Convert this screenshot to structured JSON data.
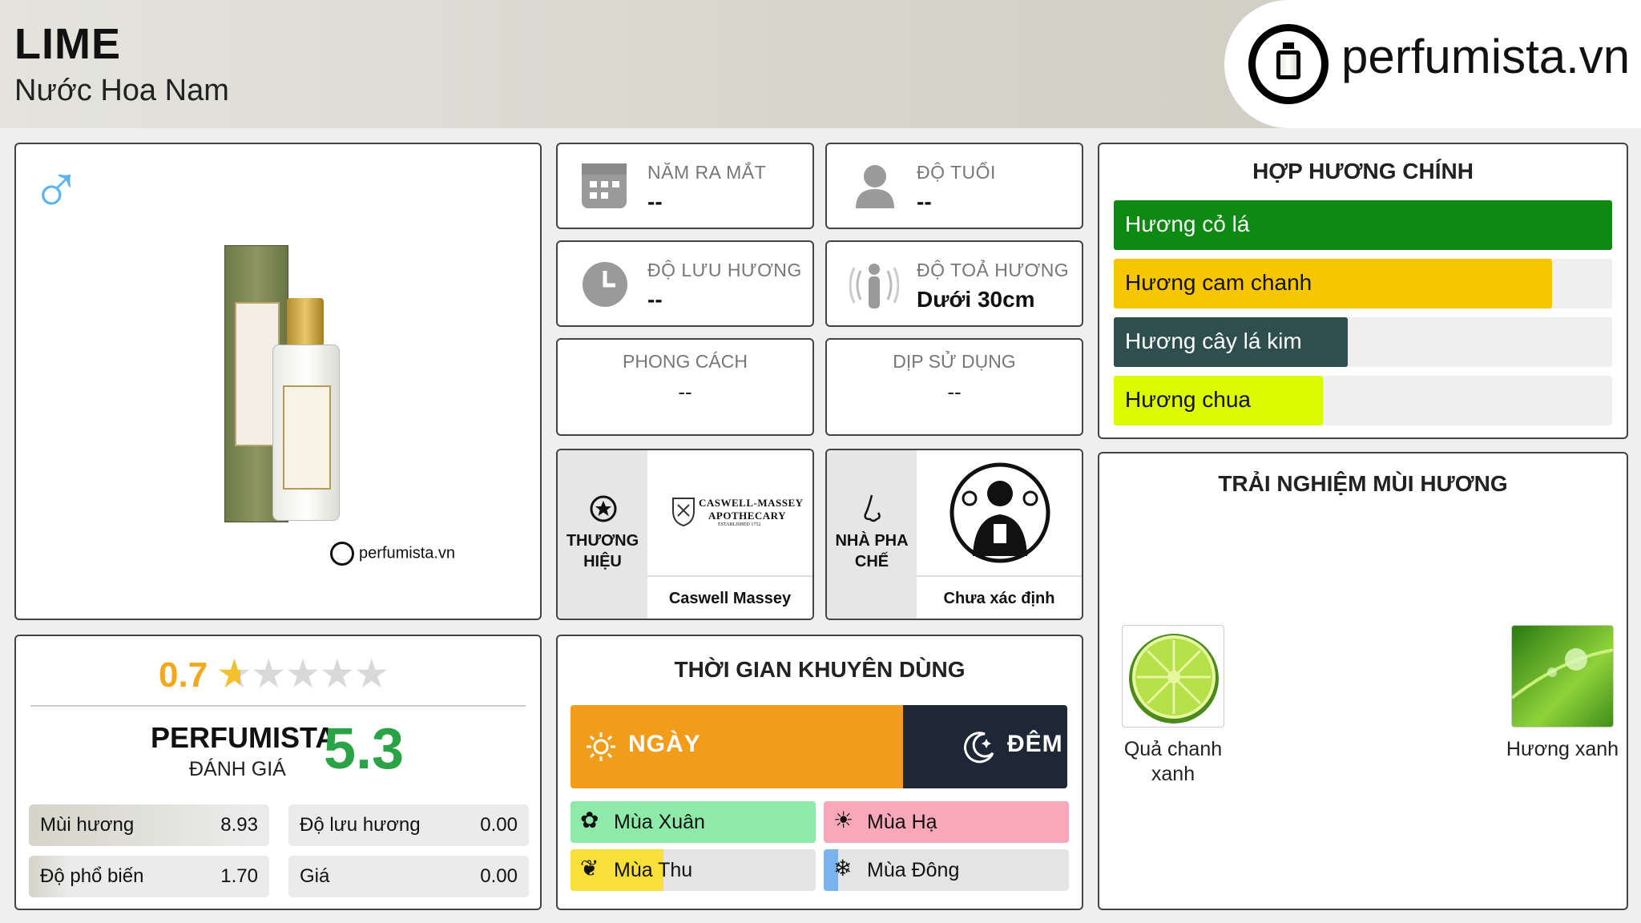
{
  "header": {
    "title": "LIME",
    "subtitle": "Nước Hoa Nam",
    "logo_text": "perfumista.vn"
  },
  "product": {
    "gender_icon": "male-icon",
    "watermark": "perfumista.vn"
  },
  "info": {
    "launch_year": {
      "label": "NĂM RA MẮT",
      "value": "--"
    },
    "age": {
      "label": "ĐỘ TUỔI",
      "value": "--"
    },
    "longevity": {
      "label": "ĐỘ LƯU HƯƠNG",
      "value": "--"
    },
    "sillage": {
      "label": "ĐỘ TOẢ HƯƠNG",
      "value": "Dưới 30cm"
    },
    "style": {
      "label": "PHONG CÁCH",
      "value": "--"
    },
    "occasion": {
      "label": "DỊP SỬ DỤNG",
      "value": "--"
    }
  },
  "brand": {
    "label_line1": "THƯƠNG",
    "label_line2": "HIỆU",
    "logo_line1": "CASWELL-MASSEY",
    "logo_line2": "APOTHECARY",
    "logo_line3": "ESTABLISHED 1752",
    "name": "Caswell Massey"
  },
  "perfumer": {
    "label_line1": "NHÀ PHA",
    "label_line2": "CHẾ",
    "name": "Chưa xác định"
  },
  "accords": {
    "title": "HỢP HƯƠNG CHÍNH",
    "items": [
      {
        "label": "Hương cỏ lá",
        "percent": 100,
        "color": "#0e8a12",
        "text_color": "#ffffff"
      },
      {
        "label": "Hương cam chanh",
        "percent": 88,
        "color": "#f8c600",
        "text_color": "#111111"
      },
      {
        "label": "Hương cây lá kim",
        "percent": 47,
        "color": "#2f4f4f",
        "text_color": "#ffffff"
      },
      {
        "label": "Hương chua",
        "percent": 42,
        "color": "#dcfa00",
        "text_color": "#111111"
      }
    ]
  },
  "rating": {
    "score": "0.7",
    "stars_filled": 0.7,
    "stars_total": 5,
    "pf_title": "PERFUMISTA",
    "pf_sub": "ĐÁNH GIÁ",
    "pf_score": "5.3",
    "metrics": [
      {
        "name": "Mùi hương",
        "value": "8.93",
        "fraction": 0.9
      },
      {
        "name": "Độ lưu hương",
        "value": "0.00",
        "fraction": 0
      },
      {
        "name": "Độ phổ biến",
        "value": "1.70",
        "fraction": 0.17
      },
      {
        "name": "Giá",
        "value": "0.00",
        "fraction": 0
      }
    ]
  },
  "time": {
    "title": "THỜI GIAN KHUYÊN DÙNG",
    "day_label": "NGÀY",
    "night_label": "ĐÊM",
    "day_fraction": 0.67,
    "seasons": [
      {
        "label": "Mùa Xuân",
        "icon": "flower-icon",
        "fraction": 1.0,
        "color": "#8eeaa8"
      },
      {
        "label": "Mùa Hạ",
        "icon": "sun-icon",
        "fraction": 1.0,
        "color": "#f8a8b8"
      },
      {
        "label": "Mùa Thu",
        "icon": "leaf-icon",
        "fraction": 0.38,
        "color": "#f8e038"
      },
      {
        "label": "Mùa Đông",
        "icon": "snowflake-icon",
        "fraction": 0.06,
        "color": "#7ab4ee"
      }
    ]
  },
  "experience": {
    "title": "TRẢI NGHIỆM MÙI HƯƠNG",
    "items": [
      {
        "label_line1": "Quả chanh",
        "label_line2": "xanh"
      },
      {
        "label_line1": "Hương xanh",
        "label_line2": ""
      }
    ]
  }
}
